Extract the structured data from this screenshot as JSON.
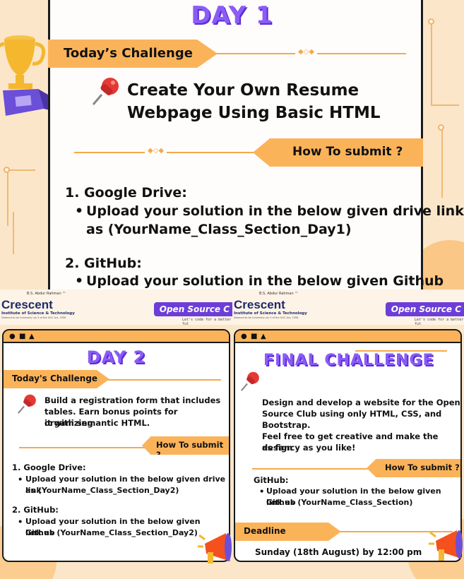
{
  "day1": {
    "title": "DAY 1",
    "challenge_label": "Today’s Challenge",
    "heading_line1": "Create Your Own Resume",
    "heading_line2": "Webpage Using Basic HTML",
    "submit_label": "How To submit ?",
    "step1_title": "1. Google Drive:",
    "step1_bullet_line1": "Upload your solution in the below given drive link",
    "step1_bullet_line2": "as (YourName_Class_Section_Day1)",
    "step2_title": "2. GitHub:",
    "step2_bullet_line1": "Upload your solution in the below given Github"
  },
  "header": {
    "logo_top": "B.S. Abdur Rahman ™",
    "logo_name": "Crescent",
    "logo_sub": "Institute of Science & Technology",
    "logo_tiny": "Deemed to be University u/s 3 of the UGC Act, 1956",
    "club_label": "Open Source C",
    "club_tag": "Let's code for a better fut"
  },
  "day2": {
    "title": "DAY 2",
    "challenge_label": "Today's Challenge",
    "desc_line1": "Build a registration form that includes",
    "desc_line2": "tables. Earn bonus points for organizing",
    "desc_line3": "it with semantic HTML.",
    "submit_label": "How To submit ?",
    "step1_title": "1. Google Drive:",
    "step1_bullet_line1": "Upload your solution in the below given drive link",
    "step1_bullet_line2": "as (YourName_Class_Section_Day2)",
    "step2_title": "2. GitHub:",
    "step2_bullet_line1": "Upload your solution in the below given Github",
    "step2_bullet_line2": "link as (YourName_Class_Section_Day2)"
  },
  "final": {
    "title": "FINAL CHALLENGE",
    "desc_line1": "Design and develop a website for the Open",
    "desc_line2": "Source Club using only HTML, CSS, and",
    "desc_line3": "Bootstrap.",
    "desc_line4": "Feel free to get creative and make the design",
    "desc_line5": "as fancy as you like!",
    "submit_label": "How To submit ?",
    "github_title": "GitHub:",
    "github_bullet_line1": "Upload your solution in the below given Github",
    "github_bullet_line2": "link as (YourName_Class_Section)",
    "deadline_label": "Deadline",
    "deadline_value": "Sunday (18th August) by 12:00 pm"
  },
  "window_controls": [
    "●",
    "■",
    "▲"
  ],
  "colors": {
    "accent_orange": "#fbb35a",
    "title_purple": "#8b5cf6",
    "club_purple": "#6c3ed7"
  }
}
